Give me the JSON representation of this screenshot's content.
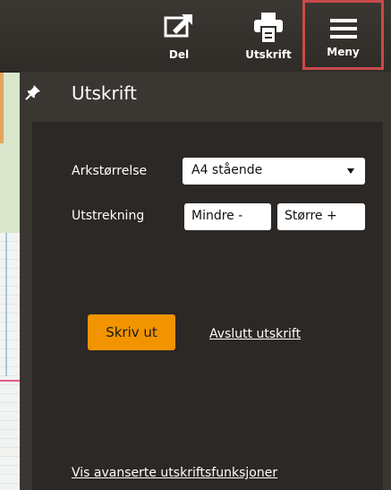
{
  "toolbar": {
    "share_label": "Del",
    "print_label": "Utskrift",
    "menu_label": "Meny"
  },
  "panel": {
    "title": "Utskrift",
    "paper_size_label": "Arkstørrelse",
    "paper_size_value": "A4 stående",
    "extent_label": "Utstrekning",
    "smaller_label": "Mindre -",
    "larger_label": "Større +",
    "print_button": "Skriv ut",
    "exit_link": "Avslutt utskrift",
    "advanced_link": "Vis avanserte utskriftsfunksjoner"
  },
  "colors": {
    "accent": "#f29400",
    "highlight_border": "#c84a4a",
    "panel_bg": "#2b2825",
    "toolbar_bg": "#3b3732"
  }
}
